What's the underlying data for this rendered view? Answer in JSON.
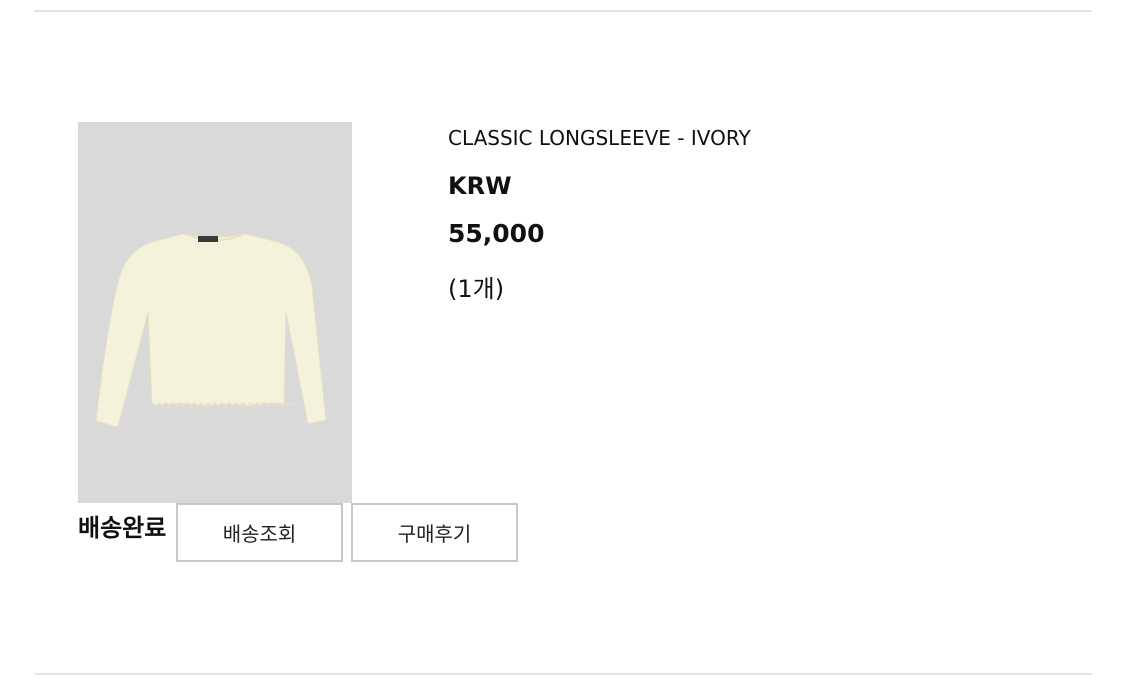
{
  "order_item": {
    "product_name": "CLASSIC LONGSLEEVE - IVORY",
    "currency": "KRW",
    "price": "55,000",
    "quantity": "(1개)",
    "status": "배송완료",
    "image": {
      "background_color": "#d9d9d9",
      "garment_color": "#f5f2dc"
    }
  },
  "actions": {
    "track_delivery_label": "배송조회",
    "write_review_label": "구매후기"
  }
}
